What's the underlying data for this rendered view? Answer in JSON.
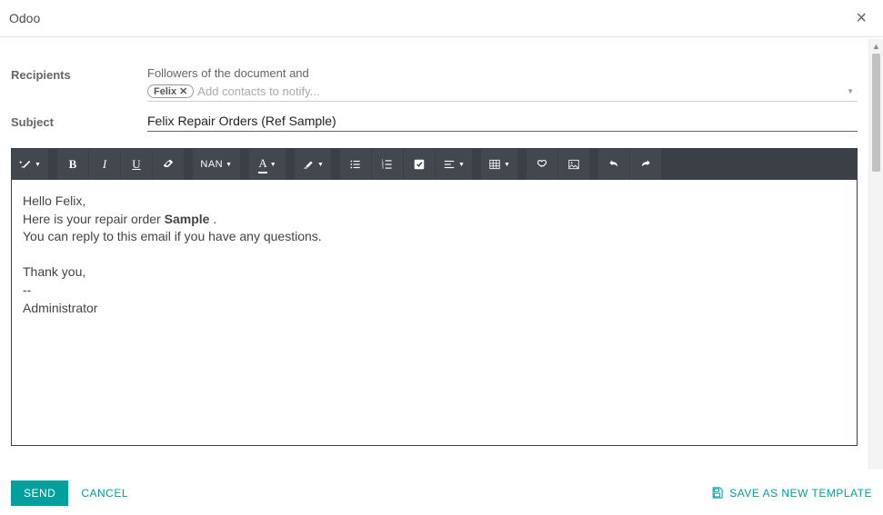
{
  "modal": {
    "title": "Odoo"
  },
  "form": {
    "recipients_label": "Recipients",
    "followers_text": "Followers of the document and",
    "tags": [
      {
        "name": "Felix"
      }
    ],
    "recipients_placeholder": "Add contacts to notify...",
    "subject_label": "Subject",
    "subject_value": "Felix Repair Orders (Ref Sample)"
  },
  "toolbar": {
    "font_size_label": "NAN",
    "font_family_label": "A"
  },
  "editor": {
    "line1": "Hello Felix,",
    "line2_pre": "Here is your repair order ",
    "line2_strong": "Sample",
    "line2_post": " .",
    "line3": "You can reply to this email if you have any questions.",
    "line_blank": " ",
    "line4": "Thank you,",
    "line5": "--",
    "line6": "Administrator"
  },
  "footer": {
    "send_label": "SEND",
    "cancel_label": "CANCEL",
    "save_template_label": "SAVE AS NEW TEMPLATE"
  }
}
